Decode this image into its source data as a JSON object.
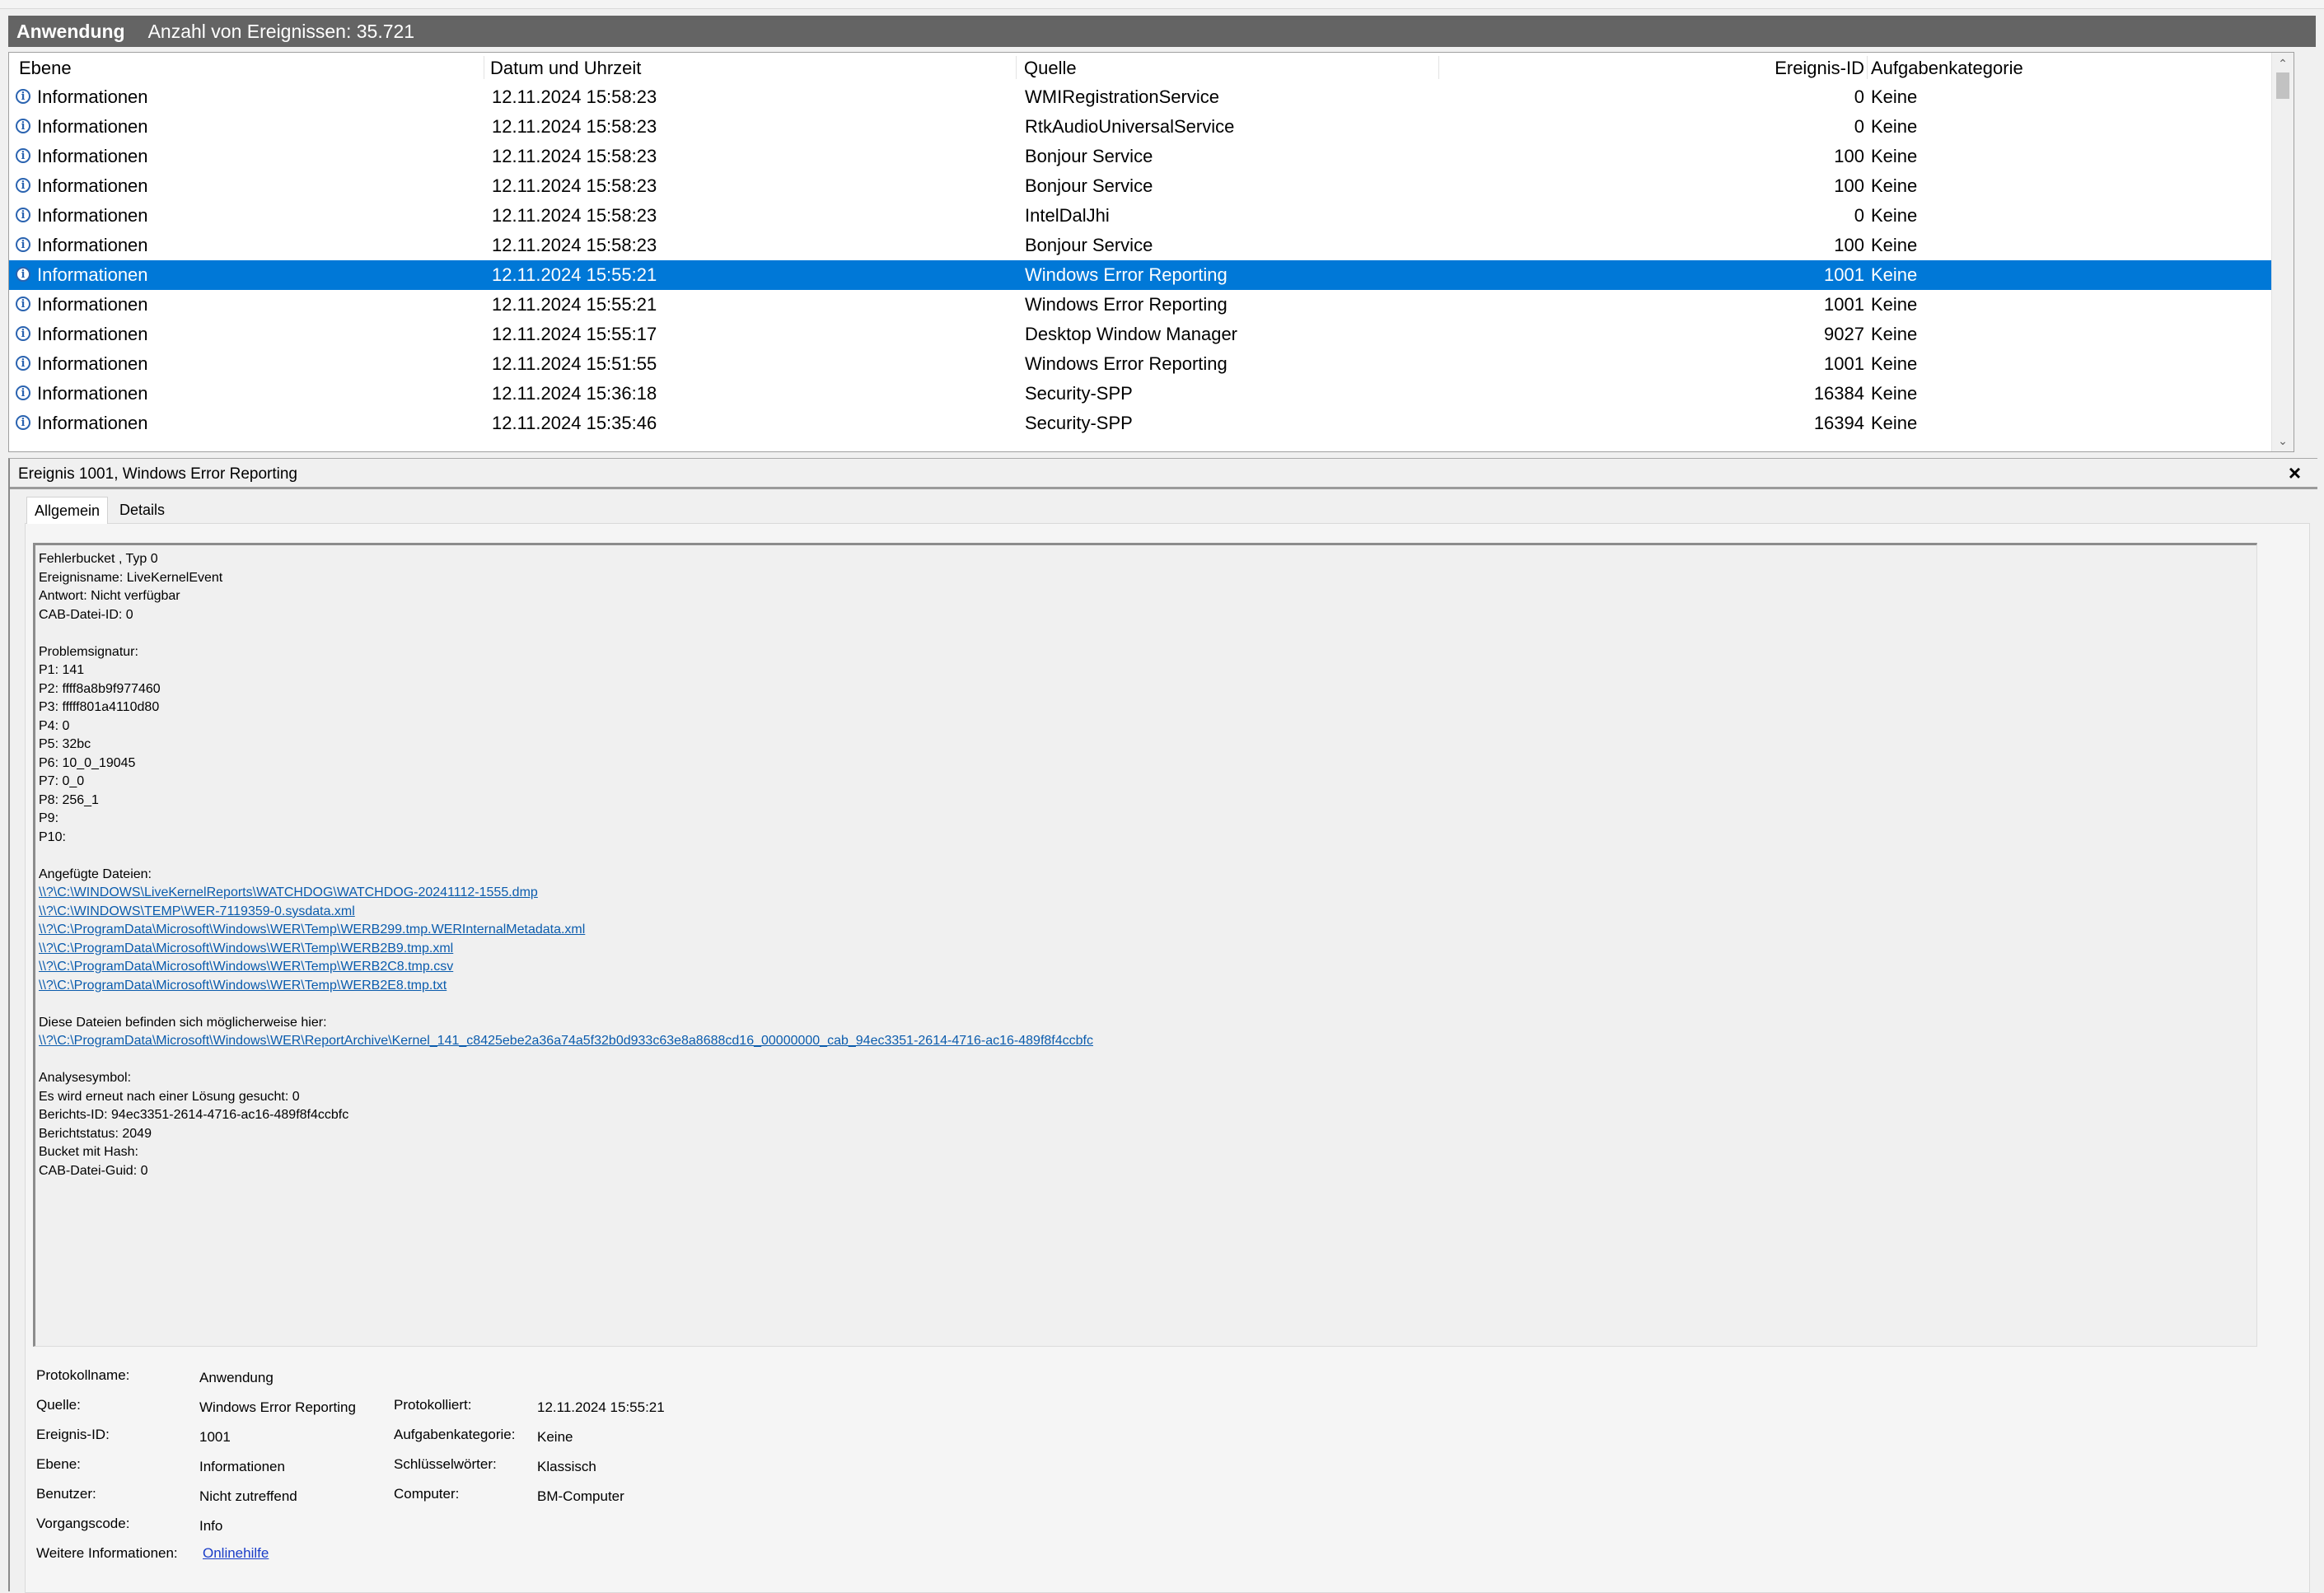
{
  "titlebar": {
    "log_name": "Anwendung",
    "event_count": "Anzahl von Ereignissen: 35.721"
  },
  "table": {
    "columns": [
      "Ebene",
      "Datum und Uhrzeit",
      "Quelle",
      "Ereignis-ID",
      "Aufgabenkategorie"
    ],
    "rows": [
      {
        "level": "Informationen",
        "date": "12.11.2024 15:58:23",
        "source": "WMIRegistrationService",
        "id": "0",
        "category": "Keine"
      },
      {
        "level": "Informationen",
        "date": "12.11.2024 15:58:23",
        "source": "RtkAudioUniversalService",
        "id": "0",
        "category": "Keine"
      },
      {
        "level": "Informationen",
        "date": "12.11.2024 15:58:23",
        "source": "Bonjour Service",
        "id": "100",
        "category": "Keine"
      },
      {
        "level": "Informationen",
        "date": "12.11.2024 15:58:23",
        "source": "Bonjour Service",
        "id": "100",
        "category": "Keine"
      },
      {
        "level": "Informationen",
        "date": "12.11.2024 15:58:23",
        "source": "IntelDalJhi",
        "id": "0",
        "category": "Keine"
      },
      {
        "level": "Informationen",
        "date": "12.11.2024 15:58:23",
        "source": "Bonjour Service",
        "id": "100",
        "category": "Keine"
      },
      {
        "level": "Informationen",
        "date": "12.11.2024 15:55:21",
        "source": "Windows Error Reporting",
        "id": "1001",
        "category": "Keine",
        "selected": true
      },
      {
        "level": "Informationen",
        "date": "12.11.2024 15:55:21",
        "source": "Windows Error Reporting",
        "id": "1001",
        "category": "Keine"
      },
      {
        "level": "Informationen",
        "date": "12.11.2024 15:55:17",
        "source": "Desktop Window Manager",
        "id": "9027",
        "category": "Keine"
      },
      {
        "level": "Informationen",
        "date": "12.11.2024 15:51:55",
        "source": "Windows Error Reporting",
        "id": "1001",
        "category": "Keine"
      },
      {
        "level": "Informationen",
        "date": "12.11.2024 15:36:18",
        "source": "Security-SPP",
        "id": "16384",
        "category": "Keine"
      },
      {
        "level": "Informationen",
        "date": "12.11.2024 15:35:46",
        "source": "Security-SPP",
        "id": "16394",
        "category": "Keine"
      }
    ],
    "icon": "info-icon",
    "selection_color": "#0078d7"
  },
  "pane": {
    "title": "Ereignis 1001, Windows Error Reporting",
    "close_label": "×",
    "tabs": [
      "Allgemein",
      "Details"
    ],
    "description": [
      {
        "t": "Fehlerbucket , Typ 0"
      },
      {
        "t": "Ereignisname: LiveKernelEvent"
      },
      {
        "t": "Antwort: Nicht verfügbar"
      },
      {
        "t": "CAB-Datei-ID: 0"
      },
      {
        "t": ""
      },
      {
        "t": "Problemsignatur:"
      },
      {
        "t": "P1: 141"
      },
      {
        "t": "P2: ffff8a8b9f977460"
      },
      {
        "t": "P3: fffff801a4110d80"
      },
      {
        "t": "P4: 0"
      },
      {
        "t": "P5: 32bc"
      },
      {
        "t": "P6: 10_0_19045"
      },
      {
        "t": "P7: 0_0"
      },
      {
        "t": "P8: 256_1"
      },
      {
        "t": "P9:"
      },
      {
        "t": "P10:"
      },
      {
        "t": ""
      },
      {
        "t": "Angefügte Dateien:"
      },
      {
        "t": "\\\\?\\C:\\WINDOWS\\LiveKernelReports\\WATCHDOG\\WATCHDOG-20241112-1555.dmp",
        "link": true
      },
      {
        "t": "\\\\?\\C:\\WINDOWS\\TEMP\\WER-7119359-0.sysdata.xml",
        "link": true
      },
      {
        "t": "\\\\?\\C:\\ProgramData\\Microsoft\\Windows\\WER\\Temp\\WERB299.tmp.WERInternalMetadata.xml",
        "link": true
      },
      {
        "t": "\\\\?\\C:\\ProgramData\\Microsoft\\Windows\\WER\\Temp\\WERB2B9.tmp.xml",
        "link": true
      },
      {
        "t": "\\\\?\\C:\\ProgramData\\Microsoft\\Windows\\WER\\Temp\\WERB2C8.tmp.csv",
        "link": true
      },
      {
        "t": "\\\\?\\C:\\ProgramData\\Microsoft\\Windows\\WER\\Temp\\WERB2E8.tmp.txt",
        "link": true
      },
      {
        "t": ""
      },
      {
        "t": "Diese Dateien befinden sich möglicherweise hier:"
      },
      {
        "t": "\\\\?\\C:\\ProgramData\\Microsoft\\Windows\\WER\\ReportArchive\\Kernel_141_c8425ebe2a36a74a5f32b0d933c63e8a8688cd16_00000000_cab_94ec3351-2614-4716-ac16-489f8f4ccbfc",
        "link": true
      },
      {
        "t": ""
      },
      {
        "t": "Analysesymbol:"
      },
      {
        "t": "Es wird erneut nach einer Lösung gesucht: 0"
      },
      {
        "t": "Berichts-ID: 94ec3351-2614-4716-ac16-489f8f4ccbfc"
      },
      {
        "t": "Berichtstatus: 2049"
      },
      {
        "t": "Bucket mit Hash:"
      },
      {
        "t": "CAB-Datei-Guid: 0"
      }
    ],
    "properties": {
      "protokollname_label": "Protokollname:",
      "protokollname": "Anwendung",
      "quelle_label": "Quelle:",
      "quelle": "Windows Error Reporting",
      "protokolliert_label": "Protokolliert:",
      "protokolliert": "12.11.2024 15:55:21",
      "ereignis_id_label": "Ereignis-ID:",
      "ereignis_id": "1001",
      "aufgabenkategorie_label": "Aufgabenkategorie:",
      "aufgabenkategorie": "Keine",
      "ebene_label": "Ebene:",
      "ebene": "Informationen",
      "schluesselwoerter_label": "Schlüsselwörter:",
      "schluesselwoerter": "Klassisch",
      "benutzer_label": "Benutzer:",
      "benutzer": "Nicht zutreffend",
      "computer_label": "Computer:",
      "computer": "BM-Computer",
      "vorgangscode_label": "Vorgangscode:",
      "vorgangscode": "Info",
      "weitere_label": "Weitere Informationen:",
      "weitere_link": "Onlinehilfe"
    }
  }
}
